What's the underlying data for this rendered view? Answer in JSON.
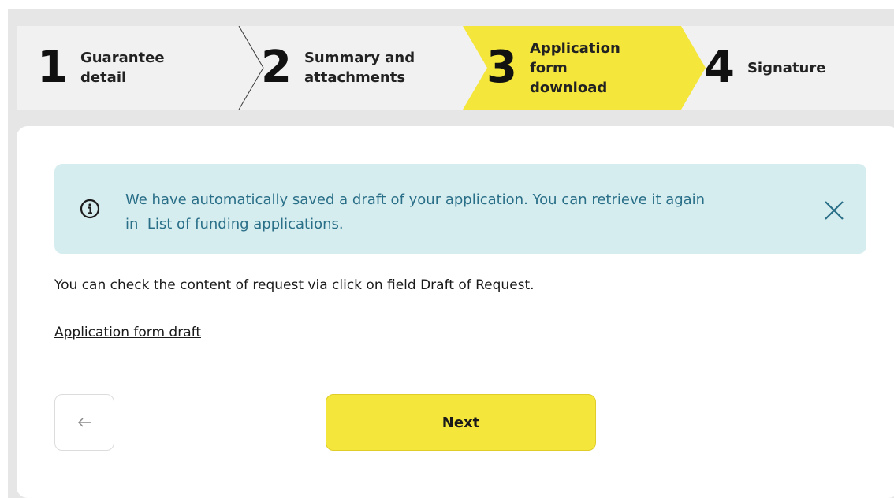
{
  "stepper": {
    "steps": [
      {
        "number": "1",
        "label_line1": "Guarantee",
        "label_line2": "detail",
        "state": "done"
      },
      {
        "number": "2",
        "label_line1": "Summary and",
        "label_line2": "attachments",
        "state": "done"
      },
      {
        "number": "3",
        "label_line1": "Application",
        "label_line2": "form",
        "label_line3": "download",
        "state": "active"
      },
      {
        "number": "4",
        "label_line1": "Signature",
        "state": "pending"
      }
    ],
    "active_color": "#f5e63c"
  },
  "alert": {
    "icon": "info-circle-icon",
    "line1": "We have automatically saved a draft of your application. You can retrieve it again",
    "line2": "in  List of funding applications.",
    "close_icon": "close-icon"
  },
  "content": {
    "intro": "You can check the content of request via click on field Draft of Request.",
    "draft_link": "Application form draft"
  },
  "actions": {
    "back_icon": "arrow-left-icon",
    "next_label": "Next"
  },
  "colors": {
    "accent": "#f4e63a",
    "alert_bg": "#d6edf0",
    "alert_text": "#2a6f88",
    "page_bg": "#e6e6e6"
  }
}
